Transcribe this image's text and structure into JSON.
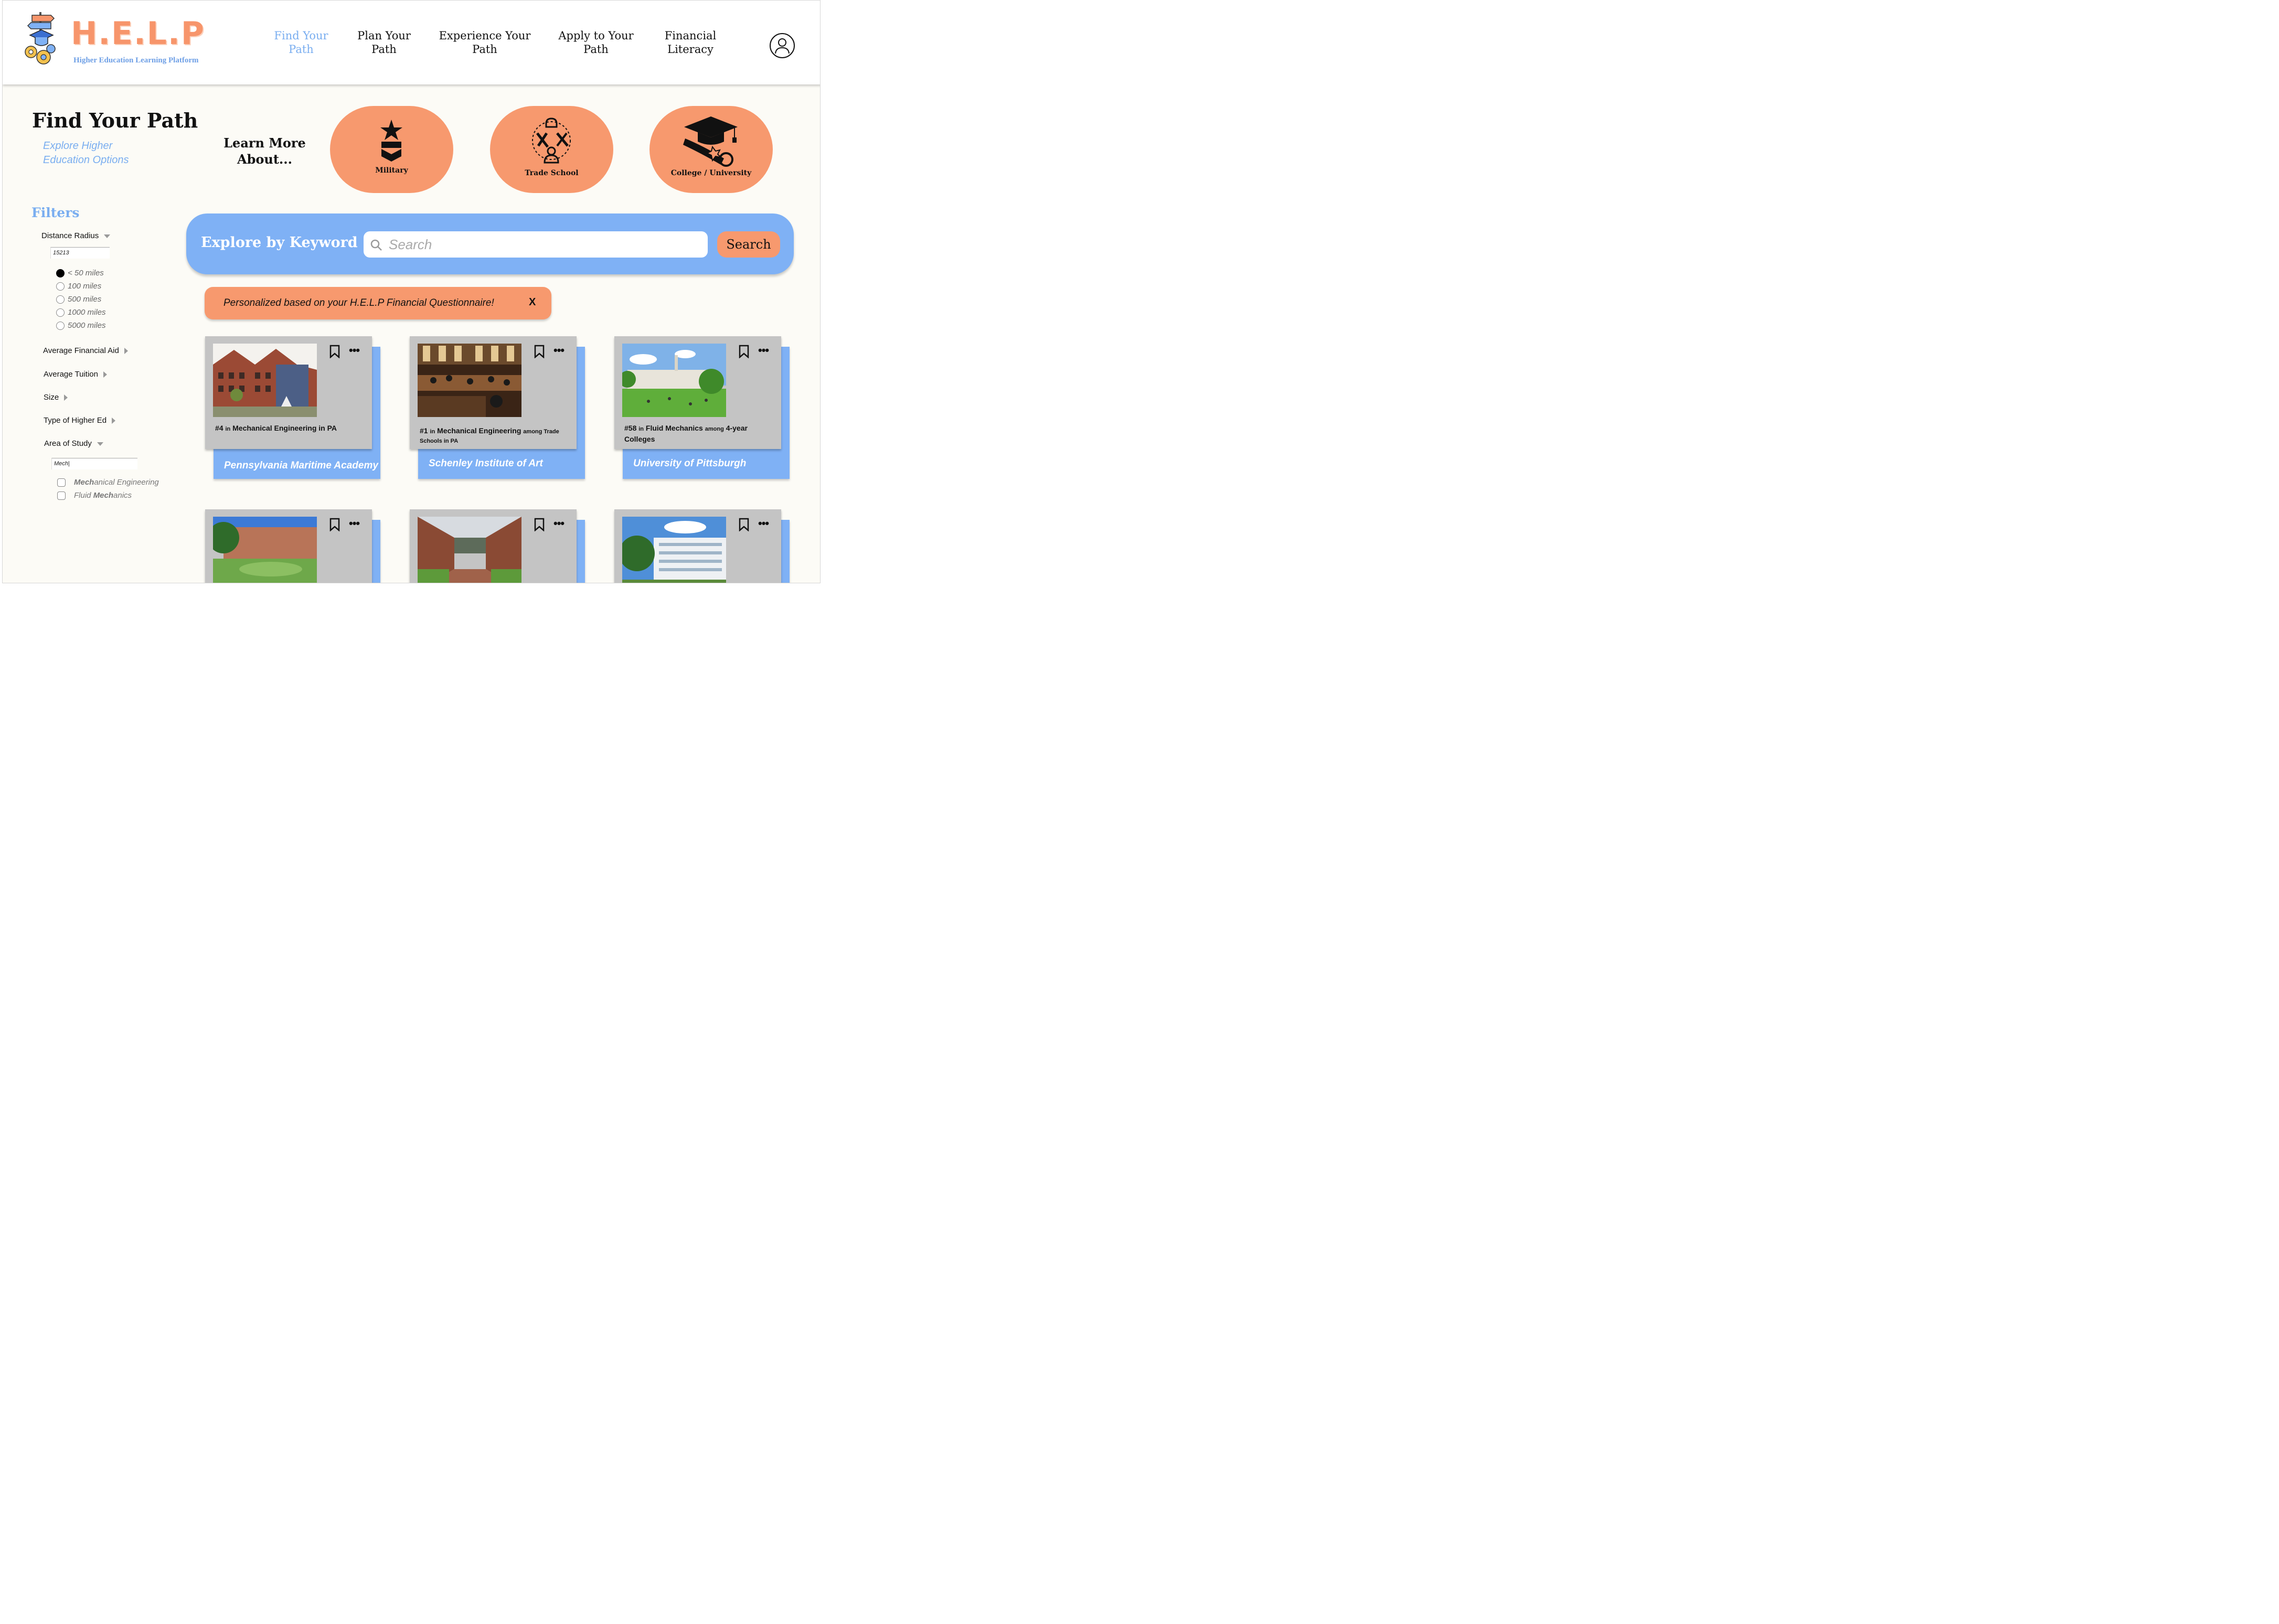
{
  "brand": {
    "title": "H.E.L.P",
    "subtitle": "Higher Education Learning Platform"
  },
  "nav": [
    {
      "line1": "Find Your",
      "line2": "Path",
      "active": true
    },
    {
      "line1": "Plan Your",
      "line2": "Path",
      "active": false
    },
    {
      "line1": "Experience Your",
      "line2": "Path",
      "active": false
    },
    {
      "line1": "Apply to Your",
      "line2": "Path",
      "active": false
    },
    {
      "line1": "Financial",
      "line2": "Literacy",
      "active": false
    }
  ],
  "hero": {
    "title": "Find Your Path",
    "subtitle_line1": "Explore Higher",
    "subtitle_line2": "Education Options",
    "learn_more_line1": "Learn More",
    "learn_more_line2": "About..."
  },
  "paths": [
    {
      "label": "Military",
      "icon": "military-star-icon"
    },
    {
      "label": "Trade School",
      "icon": "trade-tools-icon"
    },
    {
      "label": "College / University",
      "icon": "graduation-cap-diploma-icon"
    }
  ],
  "filters": {
    "title": "Filters",
    "distance_label": "Distance Radius",
    "zip_value": "15213",
    "radius_options": [
      {
        "label": "< 50 miles",
        "selected": true
      },
      {
        "label": "100 miles",
        "selected": false
      },
      {
        "label": "500 miles",
        "selected": false
      },
      {
        "label": "1000 miles",
        "selected": false
      },
      {
        "label": "5000 miles",
        "selected": false
      }
    ],
    "avg_aid_label": "Average Financial Aid",
    "avg_tuition_label": "Average Tuition",
    "size_label": "Size",
    "type_label": "Type of Higher Ed",
    "area_label": "Area of Study",
    "area_query": "Mech",
    "area_options": [
      {
        "match": "Mech",
        "rest": "anical Engineering",
        "checked": false
      },
      {
        "prefix": "Fluid ",
        "match": "Mech",
        "rest": "anics",
        "checked": false
      }
    ]
  },
  "search": {
    "heading": "Explore by Keyword",
    "placeholder": "Search",
    "button_label": "Search"
  },
  "banner": {
    "text": "Personalized based on your H.E.L.P Financial Questionnaire!",
    "close_label": "X"
  },
  "cards": [
    {
      "rank": "#4",
      "in": "in",
      "program": "Mechanical Engineering in PA",
      "among": "",
      "group": "",
      "name": "Pennsylvania Maritime Academy",
      "photo": "brick-building-photo"
    },
    {
      "rank": "#1",
      "in": "in",
      "program": "Mechanical Engineering",
      "among": "among Trade",
      "group": "Schools in PA",
      "name": "Schenley Institute of Art",
      "photo": "library-hall-photo"
    },
    {
      "rank": "#58",
      "in": "in",
      "program": "Fluid Mechanics",
      "among": "among",
      "group": "4-year",
      "group2": "Colleges",
      "name": "University of Pittsburgh",
      "photo": "campus-lawn-photo"
    }
  ],
  "colors": {
    "accent_orange": "#f7996e",
    "accent_blue": "#7fb1f5",
    "link_blue": "#7aaef0",
    "card_gray": "#c4c4c4",
    "page_bg": "#fcfbf6"
  }
}
